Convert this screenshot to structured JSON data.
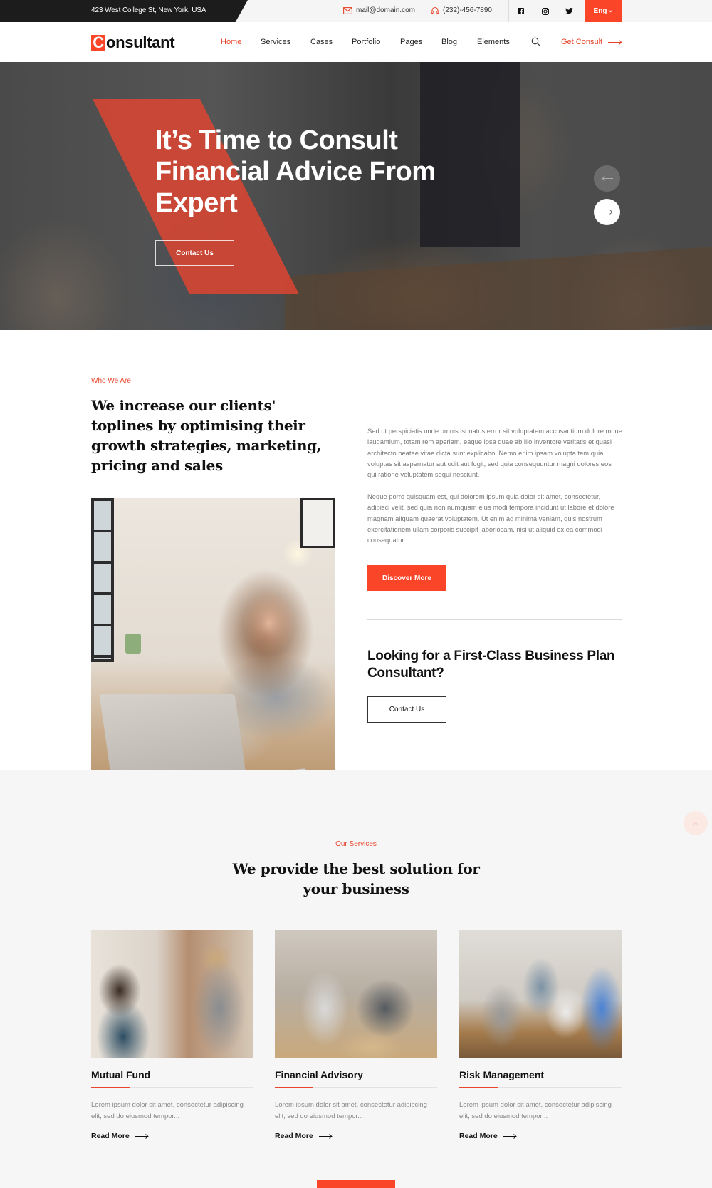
{
  "topbar": {
    "address": "423 West College St, New York, USA",
    "email": "mail@domain.com",
    "phone": "(232)-456-7890",
    "social": [
      "facebook",
      "instagram",
      "twitter"
    ],
    "language": "Eng"
  },
  "nav": {
    "logo_initial": "C",
    "logo_rest": "onsultant",
    "items": [
      {
        "label": "Home",
        "active": true
      },
      {
        "label": "Services",
        "active": false
      },
      {
        "label": "Cases",
        "active": false
      },
      {
        "label": "Portfolio",
        "active": false
      },
      {
        "label": "Pages",
        "active": false
      },
      {
        "label": "Blog",
        "active": false
      },
      {
        "label": "Elements",
        "active": false
      }
    ],
    "cta_label": "Get Consult"
  },
  "hero": {
    "title": "It’s Time to Consult Financial Advice From Expert",
    "button_label": "Contact Us"
  },
  "about": {
    "eyebrow": "Who We Are",
    "title": "We increase our clients' toplines by optimising their growth strategies, marketing, pricing and sales",
    "paragraph_1": "Sed ut perspiciatis unde omnis ist natus error sit voluptatem accusantium dolore mque laudantium, totam rem aperiam, eaque ipsa quae ab illo inventore veritatis et quasi architecto beatae vitae dicta sunt explicabo. Nemo enim ipsam volupta tem quia voluptas sit aspernatur aut odit aut fugit, sed quia consequuntur magni dolores eos qui ratione voluptatem sequi nesciunt.",
    "paragraph_2": "Neque porro quisquam est, qui dolorem ipsum quia dolor sit amet, consectetur, adipisci velit, sed quia non numquam eius modi tempora incidunt ut labore et dolore magnam aliquam quaerat voluptatem. Ut enim ad minima veniam, quis nostrum exercitationem ullam corporis suscipit laboriosam, nisi ut aliquid ex ea commodi consequatur",
    "discover_label": "Discover More",
    "cta_title": "Looking for a First-Class Business Plan Consultant?",
    "cta_button_label": "Contact Us"
  },
  "services": {
    "eyebrow": "Our Services",
    "title": "We provide the best solution for your business",
    "cards": [
      {
        "name": "Mutual Fund",
        "description": "Lorem ipsum dolor sit amet, consectetur adipiscing elit, sed do eiusmod tempor...",
        "link_label": "Read More"
      },
      {
        "name": "Financial Advisory",
        "description": "Lorem ipsum dolor sit amet, consectetur adipiscing elit, sed do eiusmod tempor...",
        "link_label": "Read More"
      },
      {
        "name": "Risk Management",
        "description": "Lorem ipsum dolor sit amet, consectetur adipiscing elit, sed do eiusmod tempor...",
        "link_label": "Read More"
      }
    ]
  },
  "colors": {
    "accent": "#fa4528",
    "accent_text": "#e8452c",
    "dark": "#1c1c1c"
  }
}
